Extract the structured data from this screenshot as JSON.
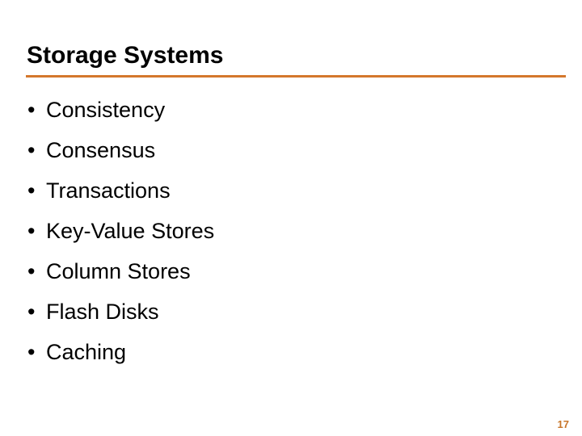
{
  "slide": {
    "title": "Storage Systems",
    "page_number": "17",
    "colors": {
      "background": "#ffffff",
      "title_text": "#000000",
      "rule": "#d4772c",
      "body_text": "#000000",
      "page_number": "#c8762b"
    },
    "bullets": [
      {
        "marker": "•",
        "label": "Consistency"
      },
      {
        "marker": "•",
        "label": "Consensus"
      },
      {
        "marker": "•",
        "label": "Transactions"
      },
      {
        "marker": "•",
        "label": "Key-Value Stores"
      },
      {
        "marker": "•",
        "label": "Column Stores"
      },
      {
        "marker": "•",
        "label": "Flash Disks"
      },
      {
        "marker": "•",
        "label": "Caching"
      }
    ]
  }
}
